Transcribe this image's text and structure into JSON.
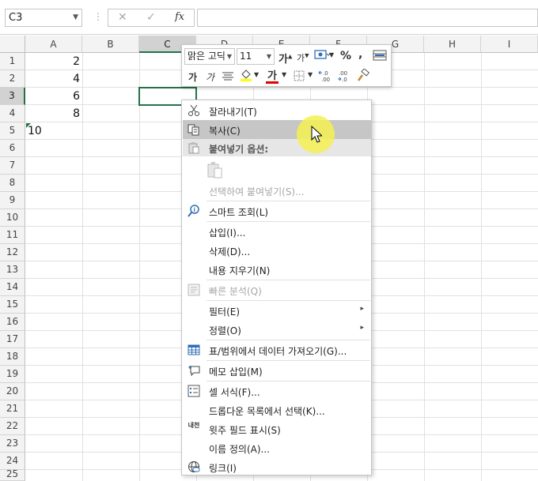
{
  "formula_bar": {
    "name_box": "C3",
    "cancel_icon": "✕",
    "enter_icon": "✓",
    "fx_label": "fx",
    "formula_value": ""
  },
  "columns": [
    "A",
    "B",
    "C",
    "D",
    "E",
    "F",
    "G",
    "H",
    "I"
  ],
  "rows": [
    "1",
    "2",
    "3",
    "4",
    "5",
    "6",
    "7",
    "8",
    "9",
    "10",
    "11",
    "12",
    "13",
    "14",
    "15",
    "16",
    "17",
    "18",
    "19",
    "20",
    "21",
    "22",
    "23",
    "24",
    "25"
  ],
  "cells": {
    "A1": "2",
    "A2": "4",
    "A3": "6",
    "A4": "8",
    "A5": "10"
  },
  "selected_cell": "C3",
  "mini_toolbar": {
    "font_name": "맑은 고딕",
    "font_size": "11",
    "grow_font": "가",
    "shrink_font": "가",
    "percent": "%",
    "comma": ",",
    "bold": "가",
    "italic": "가",
    "font_color_letter": "가",
    "colors": {
      "fill": "#ffff00",
      "font": "#e00000"
    }
  },
  "context_menu": {
    "items": [
      {
        "label": "잘라내기(T)",
        "icon": "scissors-icon"
      },
      {
        "label": "복사(C)",
        "icon": "copy-icon"
      },
      {
        "label": "붙여넣기 옵션:",
        "icon": "paste-icon"
      },
      {
        "label": "선택하여 붙여넣기(S)...",
        "icon": ""
      },
      {
        "label": "스마트 조회(L)",
        "icon": "smart-lookup-icon"
      },
      {
        "label": "삽입(I)...",
        "icon": ""
      },
      {
        "label": "삭제(D)...",
        "icon": ""
      },
      {
        "label": "내용 지우기(N)",
        "icon": ""
      },
      {
        "label": "빠른 분석(Q)",
        "icon": "quick-analysis-icon"
      },
      {
        "label": "필터(E)",
        "icon": ""
      },
      {
        "label": "정렬(O)",
        "icon": ""
      },
      {
        "label": "표/범위에서 데이터 가져오기(G)...",
        "icon": "table-icon"
      },
      {
        "label": "메모 삽입(M)",
        "icon": "comment-icon"
      },
      {
        "label": "셀 서식(F)...",
        "icon": "format-cells-icon"
      },
      {
        "label": "드롭다운 목록에서 선택(K)...",
        "icon": ""
      },
      {
        "label": "윗주 필드 표시(S)",
        "icon": "phonetic-icon"
      },
      {
        "label": "이름 정의(A)...",
        "icon": ""
      },
      {
        "label": "링크(I)",
        "icon": "link-icon"
      }
    ],
    "phonetic_icon_text": "내천",
    "submenu_arrow": "▸"
  }
}
